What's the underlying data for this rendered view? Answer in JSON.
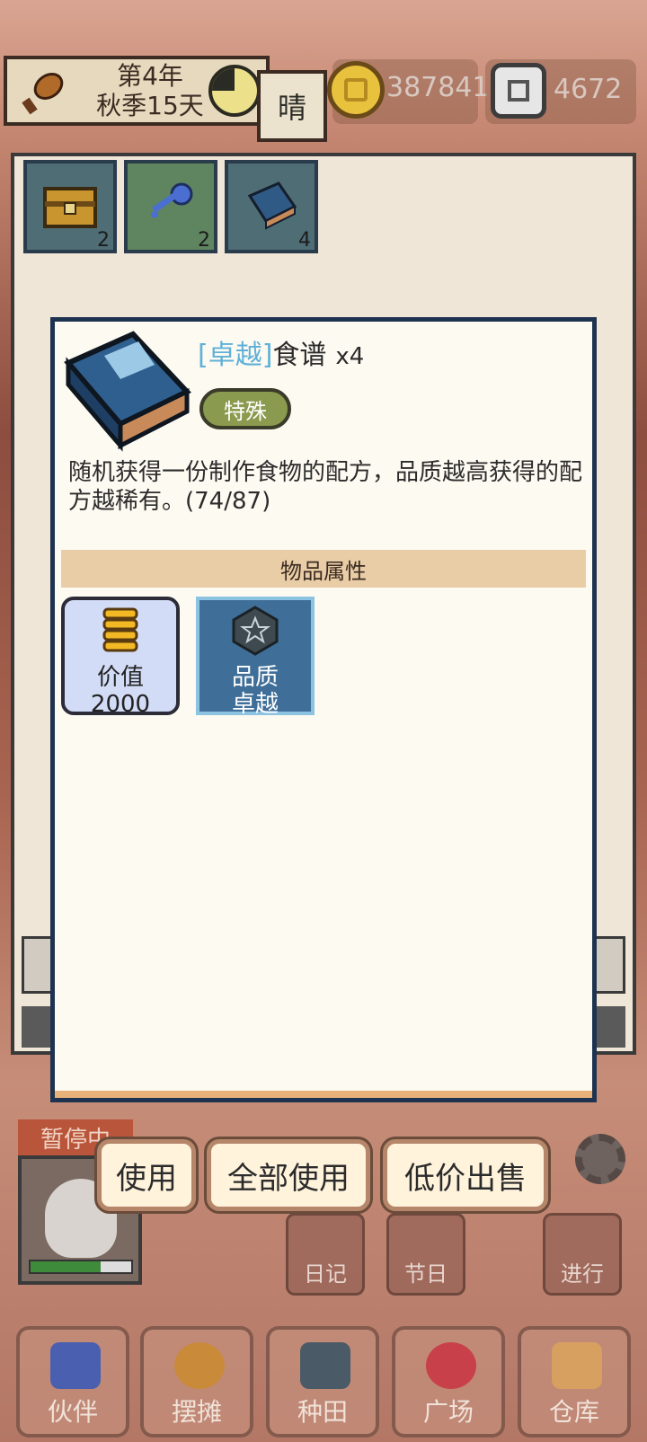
{
  "top_bar": {
    "date_line1": "第4年",
    "date_line2": "秋季15天",
    "weather": "晴",
    "coins": "387841",
    "gems": "4672"
  },
  "inventory": {
    "slots": [
      {
        "icon": "treasure-chest-icon",
        "count": "2"
      },
      {
        "icon": "key-icon",
        "count": "2"
      },
      {
        "icon": "recipe-book-icon",
        "count": "4"
      }
    ]
  },
  "item_dialog": {
    "quality_label": "[卓越]",
    "item_name": "食谱",
    "count": "x4",
    "tag": "特殊",
    "description": "随机获得一份制作食物的配方，品质越高获得的配方越稀有。(74/87)",
    "section_title": "物品属性",
    "attributes": [
      {
        "label": "价值",
        "value": "2000",
        "icon": "coin-stack-icon"
      },
      {
        "label": "品质",
        "value": "卓越",
        "icon": "quality-badge-icon"
      }
    ]
  },
  "actions": {
    "use": "使用",
    "use_all": "全部使用",
    "sell_cheap": "低价出售"
  },
  "lower_ui": {
    "paused": "暂停中",
    "side_buttons": [
      "日记",
      "节日",
      "进行"
    ],
    "tabs": [
      "伙伴",
      "摆摊",
      "种田",
      "广场",
      "仓库"
    ]
  },
  "colors": {
    "quality_color": "#5fb1d8",
    "dialog_border": "#1e3350",
    "section_bar": "#e9cda6"
  }
}
